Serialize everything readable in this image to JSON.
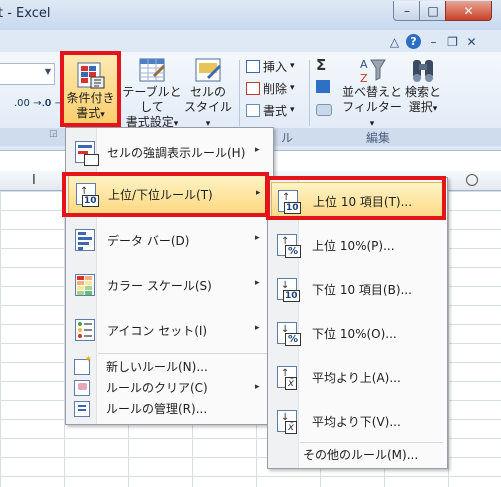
{
  "window": {
    "title": "t - Excel",
    "min_glyph": "–",
    "max_glyph": "□",
    "close_glyph": "✕"
  },
  "ribbon": {
    "tab_controls": {
      "collapse": "△",
      "help": "?",
      "min": "–",
      "restore": "❐",
      "close": "✕"
    },
    "dec_increase": ".00 →.0",
    "dec_decrease": ".0 →.00",
    "conditional_formatting": {
      "line1": "条件付き",
      "line2": "書式",
      "arrow": "▾"
    },
    "format_as_table": {
      "line1": "テーブルとして",
      "line2": "書式設定",
      "arrow": "▾"
    },
    "cell_styles": {
      "line1": "セルの",
      "line2": "スタイル",
      "arrow": "▾"
    },
    "cells": {
      "insert": "挿入",
      "delete": "削除",
      "format": "書式",
      "arrow": "▾",
      "group_label": "ル"
    },
    "editing": {
      "sigma": "Σ",
      "sort_filter": {
        "line1": "並べ替えと",
        "line2": "フィルター",
        "arrow": "▾"
      },
      "find_select": {
        "line1": "検索と",
        "line2": "選択",
        "arrow": "▾"
      },
      "group_label": "編集"
    }
  },
  "sheet": {
    "cursor": "I",
    "corner_mark": "○"
  },
  "menu_main": {
    "items": [
      {
        "label": "セルの強調表示ルール(H)",
        "icon": "highlight-rules-icon"
      },
      {
        "label": "上位/下位ルール(T)",
        "icon": "top-bottom-rules-icon"
      },
      {
        "label": "データ バー(D)",
        "icon": "data-bars-icon"
      },
      {
        "label": "カラー スケール(S)",
        "icon": "color-scales-icon"
      },
      {
        "label": "アイコン セット(I)",
        "icon": "icon-sets-icon"
      }
    ],
    "small_items": [
      {
        "label": "新しいルール(N)...",
        "icon": "new-rule-icon"
      },
      {
        "label": "ルールのクリア(C)",
        "icon": "clear-rules-icon"
      },
      {
        "label": "ルールの管理(R)...",
        "icon": "manage-rules-icon"
      }
    ],
    "submenu_arrow": "▸"
  },
  "menu_sub": {
    "items": [
      {
        "label": "上位 10 項目(T)...",
        "icon": "top10-items-icon",
        "badge": "10"
      },
      {
        "label": "上位 10%(P)...",
        "icon": "top10-percent-icon",
        "badge": "%"
      },
      {
        "label": "下位 10 項目(B)...",
        "icon": "bottom10-items-icon",
        "badge": "10"
      },
      {
        "label": "下位 10%(O)...",
        "icon": "bottom10-percent-icon",
        "badge": "%"
      },
      {
        "label": "平均より上(A)...",
        "icon": "above-average-icon",
        "badge": "x̄"
      },
      {
        "label": "平均より下(V)...",
        "icon": "below-average-icon",
        "badge": "x̄"
      }
    ],
    "more_rules": "その他のルール(M)..."
  },
  "colors": {
    "highlight_frame": "#e3151b",
    "menu_hover": "#fcd983",
    "ribbon_bg": "#dde8f5"
  }
}
